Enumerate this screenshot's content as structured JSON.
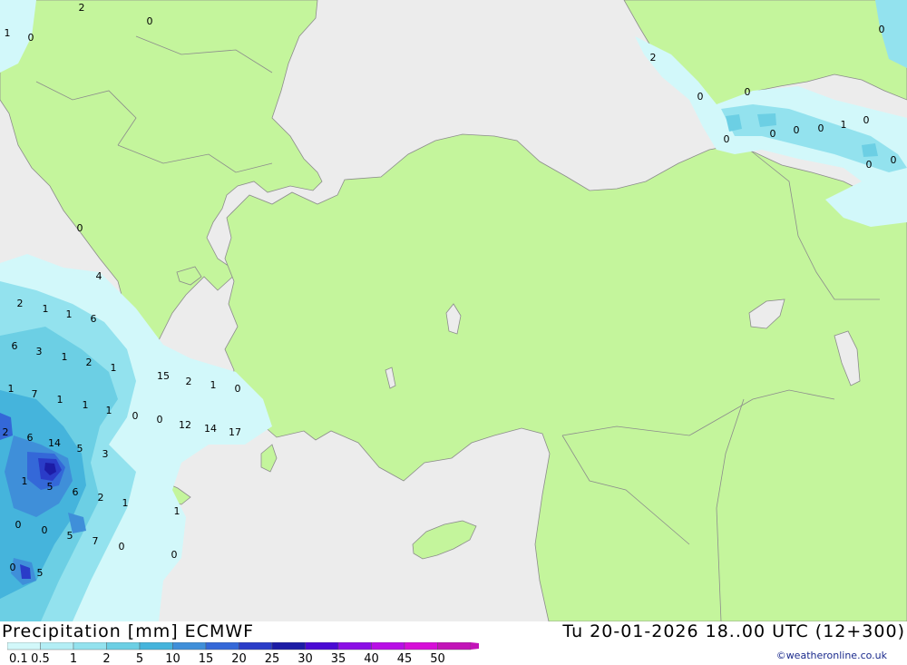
{
  "title": "Precipitation [mm] ECMWF",
  "valid_time": "Tu 20-01-2026 18..00 UTC (12+300)",
  "credit": "©weatheronline.co.uk",
  "colors": {
    "sea": "#ececec",
    "land": "#c4f59c",
    "border": "#8c8c8c"
  },
  "legend": {
    "labels": [
      "0.1",
      "0.5",
      "1",
      "2",
      "5",
      "10",
      "15",
      "20",
      "25",
      "30",
      "35",
      "40",
      "45",
      "50"
    ],
    "colors": [
      "#d2f8fa",
      "#b3eef5",
      "#93e2ee",
      "#6ccfe4",
      "#45b4dc",
      "#3f8fd9",
      "#3468d8",
      "#2a3cc8",
      "#1c1ca6",
      "#4a0ad4",
      "#8b0ee6",
      "#b80ee6",
      "#d60ed8",
      "#c214b8"
    ]
  },
  "map_labels": [
    "2",
    "0",
    "1",
    "0",
    "2",
    "0",
    "0",
    "0",
    "0",
    "0",
    "1",
    "0",
    "0",
    "0",
    "0",
    "0",
    "0",
    "4",
    "2",
    "1",
    "1",
    "6",
    "6",
    "3",
    "1",
    "2",
    "1",
    "1",
    "7",
    "1",
    "1",
    "1",
    "2",
    "1",
    "0",
    "0",
    "0",
    "15",
    "12",
    "14",
    "17",
    "2",
    "6",
    "14",
    "5",
    "3",
    "1",
    "5",
    "6",
    "2",
    "1",
    "0",
    "0",
    "5",
    "7",
    "0",
    "1",
    "0",
    "0",
    "5"
  ]
}
